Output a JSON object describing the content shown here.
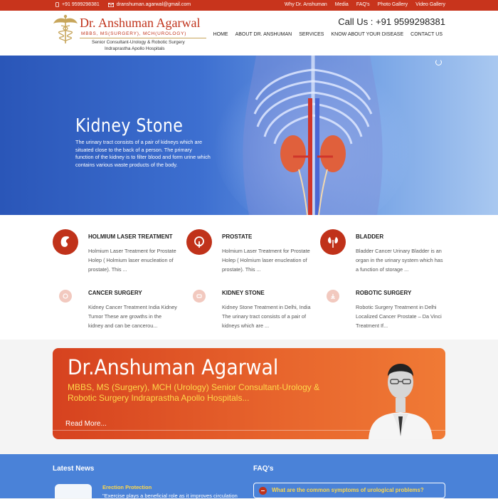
{
  "topbar": {
    "phone": "+91 9599298381",
    "email": "dranshuman.agarwal@gmail.com",
    "links": [
      "Why Dr. Anshuman",
      "Media",
      "FAQ's",
      "Photo Gallery",
      "Video Gallery"
    ]
  },
  "logo": {
    "name": "Dr. Anshuman Agarwal",
    "degrees": "MBBS, MS(SURGERY), MCH(UROLOGY)",
    "sub1": "Senior Consultant-Urology & Robotic Surgery",
    "sub2": "Indraprastha Apollo Hospitals"
  },
  "header": {
    "callus": "Call Us : +91 9599298381",
    "nav": [
      "HOME",
      "ABOUT DR. ANSHUMAN",
      "SERVICES",
      "KNOW ABOUT YOUR DISEASE",
      "CONTACT US"
    ]
  },
  "hero": {
    "title": "Kidney Stone",
    "text": "The urinary tract consists of a pair of kidneys which are situated close to the back of a person. The primary function of the kidney is to filter blood and form urine which contains various waste products of the body."
  },
  "services": [
    {
      "title": "HOLMIUM LASER TREATMENT",
      "desc": "Holmium Laser Treatment for Prostate Holep ( Holmium laser enucleation of prostate). This ...",
      "icon": "kidney-icon"
    },
    {
      "title": "PROSTATE",
      "desc": "Holmium Laser Treatment for Prostate Holep ( Holmium laser enucleation of prostate). This ...",
      "icon": "prostate-icon"
    },
    {
      "title": "BLADDER",
      "desc": "Bladder Cancer Urinary Bladder is an organ in the urinary system which has a function of storage ...",
      "icon": "bladder-icon"
    },
    {
      "title": "CANCER SURGERY",
      "desc": "Kidney Cancer Treatment India Kidney Tumor These are growths in the kidney and can be cancerou...",
      "icon": "cancer-surgery-icon"
    },
    {
      "title": "KIDNEY STONE",
      "desc": "Kidney Stone Treatment in Delhi, India The urinary tract consists of a pair of kidneys which are ...",
      "icon": "kidney-stone-icon"
    },
    {
      "title": "ROBOTIC SURGERY",
      "desc": "Robotic Surgery Treatment in Delhi Localized Cancer Prostate – Da Vinci Treatment If...",
      "icon": "robotic-surgery-icon"
    }
  ],
  "banner": {
    "name": "Dr.Anshuman Agarwal",
    "degrees": "MBBS, MS (Surgery), MCH (Urology) Senior Consultant-Urology & Robotic Surgery Indraprastha Apollo Hospitals...",
    "more": "Read More..."
  },
  "news": {
    "heading": "Latest News",
    "item_title": "Erection Protection",
    "item_text": "\"Exercise plays a beneficial role as it improves circulation"
  },
  "faq": {
    "heading": "FAQ's",
    "question": "What are the common symptoms of urological problems?"
  },
  "colors": {
    "brand_red": "#c0321a",
    "accent_yellow": "#ffd84a",
    "footer_blue": "#4a82d8"
  }
}
